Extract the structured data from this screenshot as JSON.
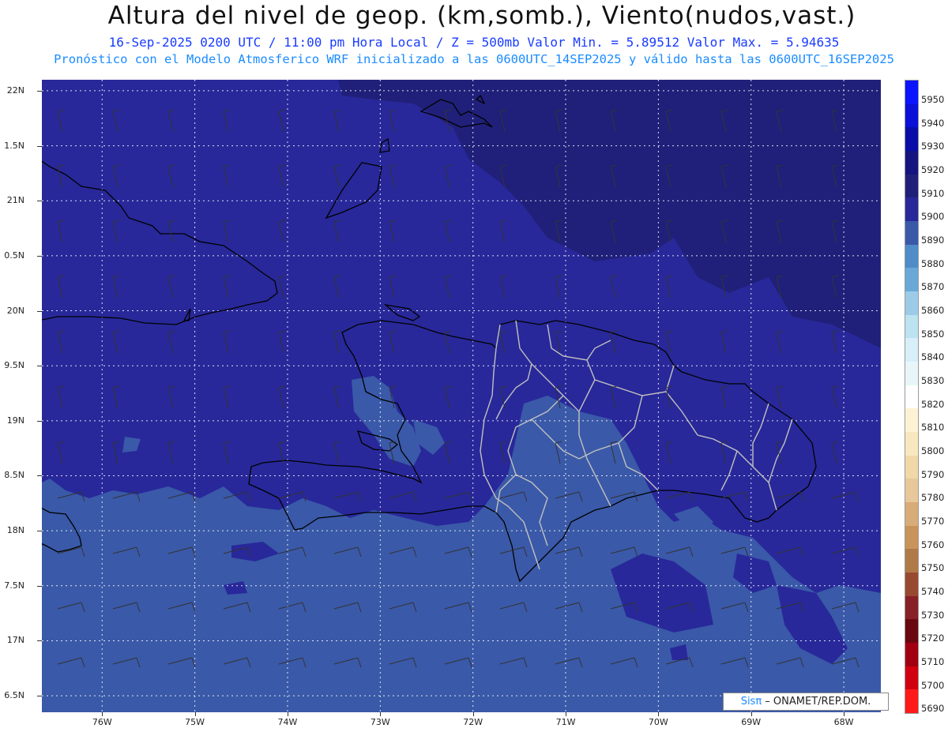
{
  "title": "Altura del nivel de geop. (km,somb.), Viento(nudos,vast.)",
  "subtitle_1": "16-Sep-2025  0200 UTC / 11:00 pm Hora Local / Z = 500mb    Valor Min. = 5.89512  Valor Max. = 5.94635",
  "subtitle_2": "Pronóstico con el Modelo Atmosferico WRF inicializado a las 0600UTC_14SEP2025 y válido hasta las  0600UTC_16SEP2025",
  "credit": {
    "brand": "Sisπ",
    "text": " – ONAMET/REP.DOM."
  },
  "map": {
    "lat_range": [
      16.35,
      22.1
    ],
    "lon_range": [
      -76.65,
      -67.6
    ],
    "lat_labels": [
      "22N",
      "1.5N",
      "21N",
      "0.5N",
      "20N",
      "9.5N",
      "19N",
      "8.5N",
      "18N",
      "7.5N",
      "17N",
      "6.5N"
    ],
    "lon_labels": [
      "76W",
      "75W",
      "74W",
      "73W",
      "72W",
      "71W",
      "70W",
      "69W",
      "68W"
    ],
    "colors": {
      "dark_5920": "#20207a",
      "mid_5910": "#28289a",
      "light_5900": "#3a59a8",
      "coast": "#000000",
      "borders": "#c0c0c0",
      "grid": "#ffffff",
      "barbs": "#333333"
    }
  },
  "colorbar": {
    "levels": [
      "5950",
      "5940",
      "5930",
      "5920",
      "5910",
      "5900",
      "5890",
      "5880",
      "5870",
      "5860",
      "5850",
      "5840",
      "5830",
      "5820",
      "5810",
      "5800",
      "5790",
      "5780",
      "5770",
      "5760",
      "5750",
      "5740",
      "5730",
      "5720",
      "5710",
      "5700",
      "5690"
    ],
    "colors": [
      "#0a14ff",
      "#0a10d8",
      "#0a0ca8",
      "#151580",
      "#20207a",
      "#28289a",
      "#3a59a8",
      "#4f8cc8",
      "#6aa8d8",
      "#9ccbe8",
      "#bde2f0",
      "#d8eef8",
      "#e8f6fa",
      "#ffffff",
      "#fdf3d4",
      "#f8e8c0",
      "#f0d8a8",
      "#e8c89a",
      "#d8ac78",
      "#c8945c",
      "#b07a48",
      "#984a30",
      "#882028",
      "#6a0810",
      "#a00010",
      "#d00010",
      "#ff1a1a"
    ]
  }
}
